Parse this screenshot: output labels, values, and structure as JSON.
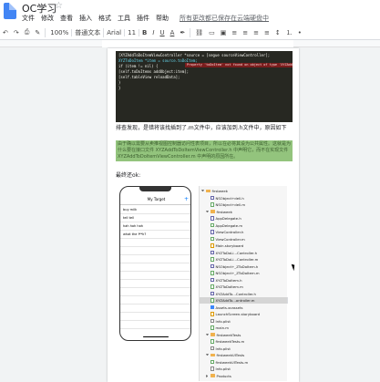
{
  "app": {
    "doc_title": "OC学习",
    "menus": [
      "文件",
      "修改",
      "查看",
      "插入",
      "格式",
      "工具",
      "插件",
      "帮助"
    ],
    "save_note": "所有更改都已保存在云端硬盘中"
  },
  "toolbar": {
    "zoom": "100%",
    "style": "普通文本",
    "font": "Arial",
    "font_size": "11",
    "buttons": [
      "B",
      "I",
      "U",
      "A"
    ]
  },
  "code": {
    "lines": [
      "    [XYZAddToDoItemViewController *source = [segue sourceViewController];",
      "    XYZToDoItem *item = source.toDoItem;",
      "    if (item != nil) {",
      "        [self.toDoItems addObject:item];",
      "        [self.tableView reloadData];",
      "    }",
      "}"
    ],
    "warning": "Property 'toDoItem' not found on object of type 'XYZAddToDoItemViewController *'"
  },
  "body": {
    "para1": "排查发现，是错将该找插到了.m文件中，应该加到.h文件中，原因如下",
    "highlight_text": "由于确以需要从卖推视图控制器访问性表项目，所以在必将其设为公共属性。这就是为什么要在接口文件 XYZAddToDoItemViewController.h 中声明它，而不在实现文件 XYZAddToDoItemViewController.m 中声明的原因所在。",
    "para2": "最终还ok:"
  },
  "phone": {
    "nav_title": "My Target",
    "plus": "+",
    "cells": [
      "buy milk",
      "tell tell",
      "hah hah hah",
      "what the f**k?"
    ]
  },
  "navigator": {
    "rows": [
      {
        "label": "firstweek",
        "kind": "folder",
        "indent": 0,
        "open": true
      },
      {
        "label": "NSObject+dell.h",
        "kind": "h",
        "indent": 2
      },
      {
        "label": "NSObject+dell.m",
        "kind": "m",
        "indent": 2
      },
      {
        "label": "firstweek",
        "kind": "folder",
        "indent": 1,
        "open": true
      },
      {
        "label": "AppDelegate.h",
        "kind": "h",
        "indent": 2
      },
      {
        "label": "AppDelegate.m",
        "kind": "m",
        "indent": 2
      },
      {
        "label": "ViewController.h",
        "kind": "h",
        "indent": 2
      },
      {
        "label": "ViewController.m",
        "kind": "m",
        "indent": 2
      },
      {
        "label": "Main.storyboard",
        "kind": "sb",
        "indent": 2
      },
      {
        "label": "XYZToDoLi...Controller.h",
        "kind": "h",
        "indent": 2
      },
      {
        "label": "XYZToDoLi...Controller.m",
        "kind": "m",
        "indent": 2
      },
      {
        "label": "NSObject+_ZToDoItem.h",
        "kind": "h",
        "indent": 2
      },
      {
        "label": "NSObject+_ZToDoItem.m",
        "kind": "m",
        "indent": 2
      },
      {
        "label": "XYZToDoItem.h",
        "kind": "h",
        "indent": 2
      },
      {
        "label": "XYZToDoItem.m",
        "kind": "m",
        "indent": 2
      },
      {
        "label": "XYZAddTo...Controller.h",
        "kind": "h",
        "indent": 2
      },
      {
        "label": "XYZAddTo...ontroller.m",
        "kind": "m",
        "indent": 2,
        "selected": true
      },
      {
        "label": "Assets.xcassets",
        "kind": "as",
        "indent": 2
      },
      {
        "label": "LaunchScreen.storyboard",
        "kind": "sb",
        "indent": 2
      },
      {
        "label": "Info.plist",
        "kind": "pl",
        "indent": 2
      },
      {
        "label": "main.m",
        "kind": "m",
        "indent": 2
      },
      {
        "label": "firstweekTests",
        "kind": "folder",
        "indent": 1,
        "open": true
      },
      {
        "label": "firstweekTests.m",
        "kind": "m",
        "indent": 2
      },
      {
        "label": "Info.plist",
        "kind": "pl",
        "indent": 2
      },
      {
        "label": "firstweekUITests",
        "kind": "folder",
        "indent": 1,
        "open": true
      },
      {
        "label": "firstweekUITests.m",
        "kind": "m",
        "indent": 2
      },
      {
        "label": "Info.plist",
        "kind": "pl",
        "indent": 2
      },
      {
        "label": "Products",
        "kind": "folder",
        "indent": 1,
        "open": false
      }
    ]
  }
}
